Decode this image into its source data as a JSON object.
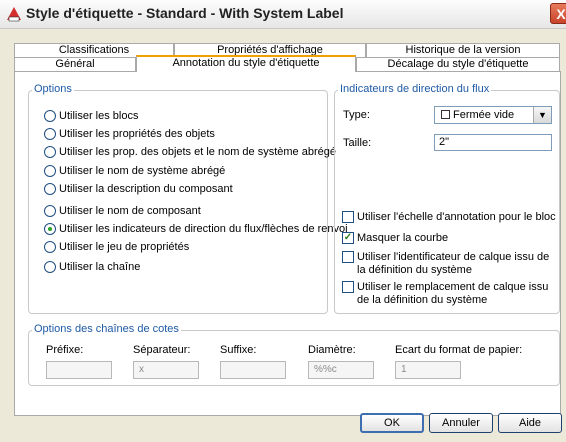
{
  "window": {
    "title": "Style d'étiquette - Standard - With System Label",
    "close_glyph": "X"
  },
  "tabs": {
    "row1": [
      "Classifications",
      "Propriétés d'affichage",
      "Historique de la version"
    ],
    "row2": [
      "Général",
      "Annotation du style d'étiquette",
      "Décalage du style d'étiquette"
    ],
    "active": "Annotation du style d'étiquette"
  },
  "options": {
    "title": "Options",
    "items": [
      {
        "label": "Utiliser les blocs",
        "checked": false
      },
      {
        "label": "Utiliser les propriétés des objets",
        "checked": false
      },
      {
        "label": "Utiliser les prop. des objets et le nom de système abrégé",
        "checked": false
      },
      {
        "label": "Utiliser le nom de système abrégé",
        "checked": false
      },
      {
        "label": "Utiliser la description du composant",
        "checked": false
      },
      {
        "label": "Utiliser le nom de composant",
        "checked": false
      },
      {
        "label": "Utiliser les indicateurs de direction du flux/flèches de renvoi",
        "checked": true
      },
      {
        "label": "Utiliser le jeu de propriétés",
        "checked": false
      },
      {
        "label": "Utiliser la chaîne",
        "checked": false
      }
    ]
  },
  "flow": {
    "title": "Indicateurs de direction du flux",
    "type_label": "Type:",
    "type_value": "Fermée vide",
    "size_label": "Taille:",
    "size_value": "2\"",
    "checkboxes": [
      {
        "label": "Utiliser l'échelle d'annotation pour le bloc",
        "checked": false
      },
      {
        "label": "Masquer la courbe",
        "checked": true
      },
      {
        "label": "Utiliser l'identificateur de calque issu de la définition du système",
        "checked": false
      },
      {
        "label": "Utiliser le remplacement de calque issu de la définition du système",
        "checked": false
      }
    ]
  },
  "cotes": {
    "title": "Options des chaînes de cotes",
    "fields": [
      {
        "label": "Préfixe:",
        "value": ""
      },
      {
        "label": "Séparateur:",
        "value": "x"
      },
      {
        "label": "Suffixe:",
        "value": ""
      },
      {
        "label": "Diamètre:",
        "value": "%%c"
      },
      {
        "label": "Ecart du format de papier:",
        "value": "1"
      }
    ]
  },
  "buttons": {
    "ok": "OK",
    "cancel": "Annuler",
    "help": "Aide"
  },
  "colors": {
    "accent": "#1f5aa6",
    "active_tab": "#f0a000",
    "radio_dot": "#27a32a"
  }
}
